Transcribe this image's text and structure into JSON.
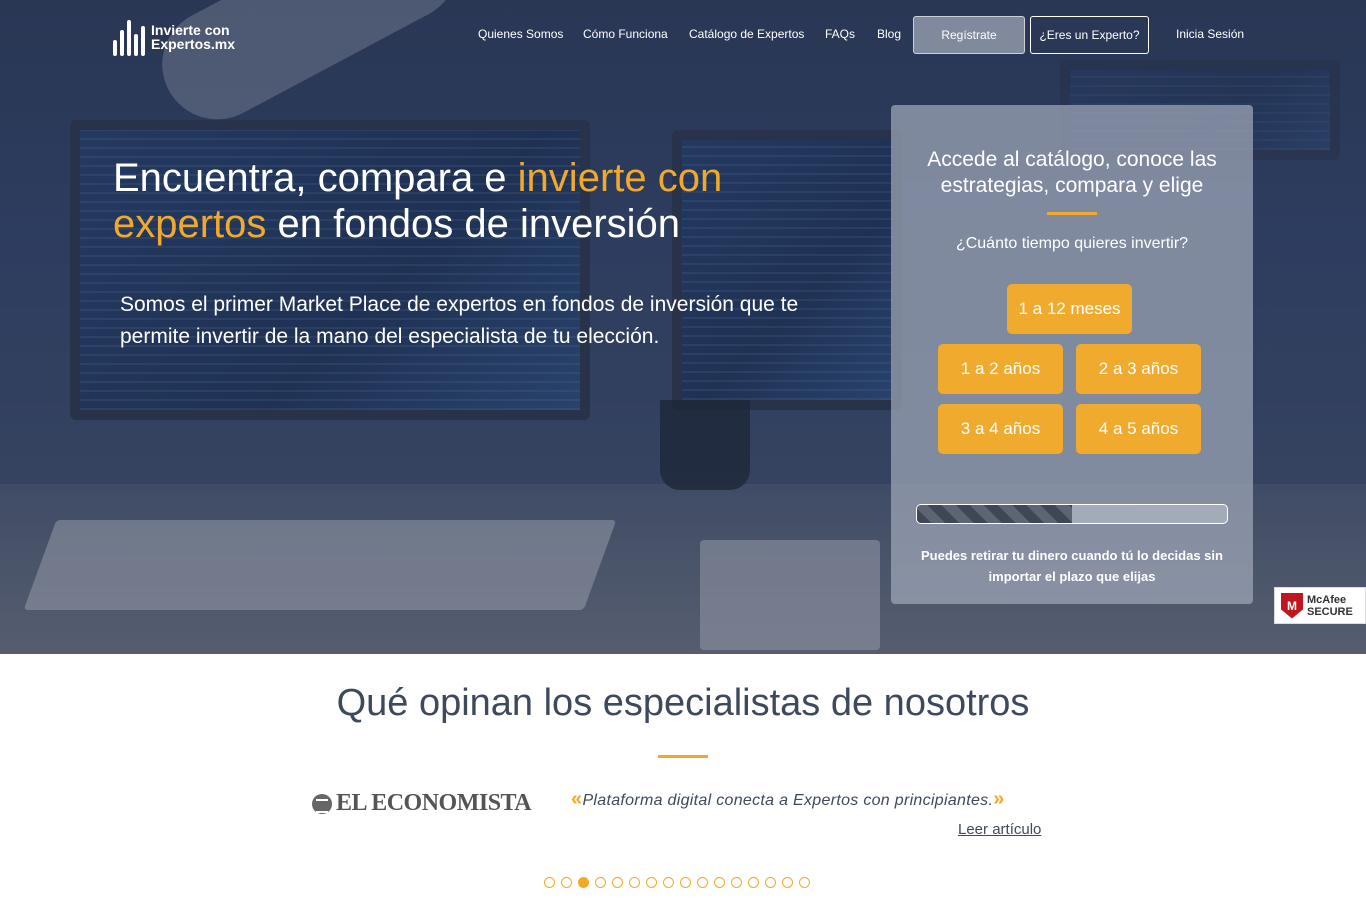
{
  "brand": {
    "logo_line1": "Invierte con",
    "logo_line2": "Expertos.mx"
  },
  "nav": {
    "items": [
      "Quienes Somos",
      "Cómo Funciona",
      "Catálogo de Expertos",
      "FAQs",
      "Blog"
    ],
    "register_label": "Regístrate",
    "expert_label": "¿Eres un Experto?",
    "login_label": "Inicia Sesión"
  },
  "hero": {
    "headline_part1": "Encuentra, compara e ",
    "headline_accent1": "invierte con",
    "headline_accent2": "expertos",
    "headline_part2": " en fondos de inversión",
    "subtitle": "Somos el primer Market Place de expertos en fondos de inversión que te permite invertir de la mano del especialista de tu elección."
  },
  "card": {
    "title": "Accede al catálogo, conoce las estrategias, compara y elige",
    "question": "¿Cuánto tiempo quieres invertir?",
    "options": [
      "1 a 12 meses",
      "1 a 2 años",
      "2 a 3 años",
      "3 a 4 años",
      "4 a 5 años"
    ],
    "progress": 0.5,
    "note": "Puedes retirar tu dinero cuando tú lo decidas sin importar el plazo que elijas"
  },
  "badge": {
    "line1": "McAfee",
    "line2": "SECURE"
  },
  "testimonials": {
    "title": "Qué opinan los especialistas de nosotros",
    "press_name": "EL ECONOMISTA",
    "quote_open": "«",
    "quote": "Plataforma digital conecta a Expertos con principiantes.",
    "quote_close": "»",
    "link_label": "Leer artículo",
    "dots_count": 16,
    "active_dot": 2
  },
  "colors": {
    "accent": "#f0a92c",
    "hero_bg": "#34456a",
    "text_dark": "#3e4a5c"
  }
}
